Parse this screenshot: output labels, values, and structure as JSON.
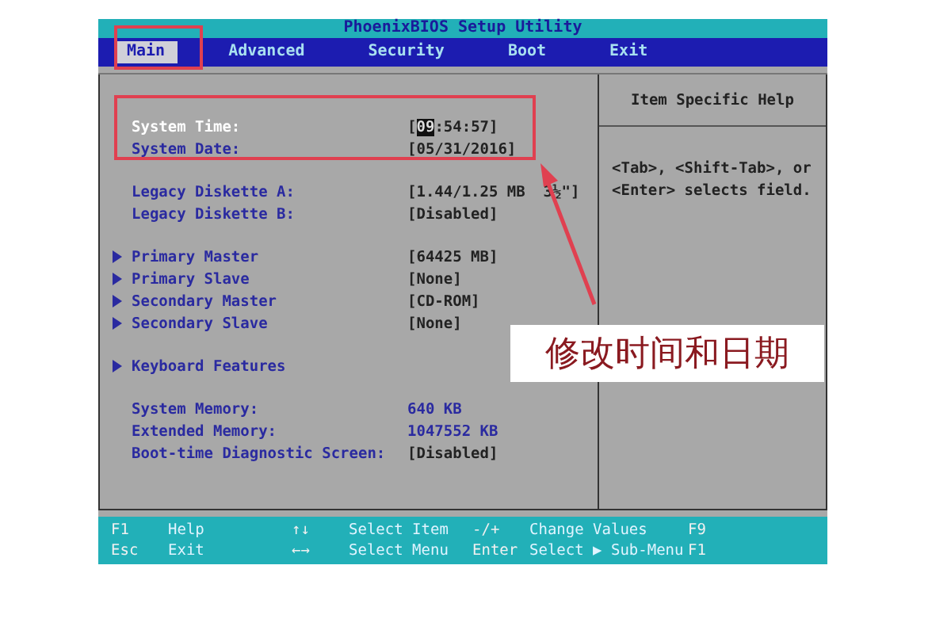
{
  "title": "PhoenixBIOS Setup Utility",
  "tabs": [
    {
      "label": "Main",
      "selected": true
    },
    {
      "label": "Advanced",
      "selected": false
    },
    {
      "label": "Security",
      "selected": false
    },
    {
      "label": "Boot",
      "selected": false
    },
    {
      "label": "Exit",
      "selected": false
    }
  ],
  "groups": [
    [
      {
        "kind": "field",
        "label": "System Time:",
        "value_before": "[",
        "value_field": "09",
        "value_after": ":54:57]",
        "selected": true
      },
      {
        "kind": "field",
        "label": "System Date:",
        "value_before": "[",
        "value_after": "05/31/2016]",
        "selected": false
      }
    ],
    [
      {
        "kind": "field",
        "label": "Legacy Diskette A:",
        "value_before": "[1.44/1.25 MB  3½\"]",
        "selected": false
      },
      {
        "kind": "field",
        "label": "Legacy Diskette B:",
        "value_before": "[Disabled]",
        "selected": false
      }
    ],
    [
      {
        "kind": "submenu",
        "label": "Primary Master",
        "value_before": "[64425 MB]",
        "selected": false
      },
      {
        "kind": "submenu",
        "label": "Primary Slave",
        "value_before": "[None]",
        "selected": false
      },
      {
        "kind": "submenu",
        "label": "Secondary Master",
        "value_before": "[CD-ROM]",
        "selected": false
      },
      {
        "kind": "submenu",
        "label": "Secondary Slave",
        "value_before": "[None]",
        "selected": false
      }
    ],
    [
      {
        "kind": "submenu",
        "label": "Keyboard Features",
        "selected": false
      }
    ],
    [
      {
        "kind": "info",
        "label": "System Memory:",
        "value_before": "640 KB",
        "selected": false
      },
      {
        "kind": "info",
        "label": "Extended Memory:",
        "value_before": "1047552 KB",
        "selected": false
      },
      {
        "kind": "field",
        "label": "Boot-time Diagnostic Screen:",
        "value_before": "[Disabled]",
        "selected": false
      }
    ]
  ],
  "help": {
    "title": "Item Specific Help",
    "text": "<Tab>, <Shift-Tab>, or <Enter> selects field."
  },
  "footer": [
    [
      {
        "key": "F1",
        "desc": "Help"
      },
      {
        "key": "↑↓",
        "desc": "Select Item"
      },
      {
        "key": "-/+",
        "desc": "Change Values"
      },
      {
        "key": "F9"
      }
    ],
    [
      {
        "key": "Esc",
        "desc": "Exit"
      },
      {
        "key": "←→",
        "desc": "Select Menu"
      },
      {
        "key": "Enter",
        "desc": "Select ▶ Sub-Menu"
      },
      {
        "key": "F1"
      }
    ]
  ],
  "annotation": {
    "caption": "修改时间和日期"
  }
}
